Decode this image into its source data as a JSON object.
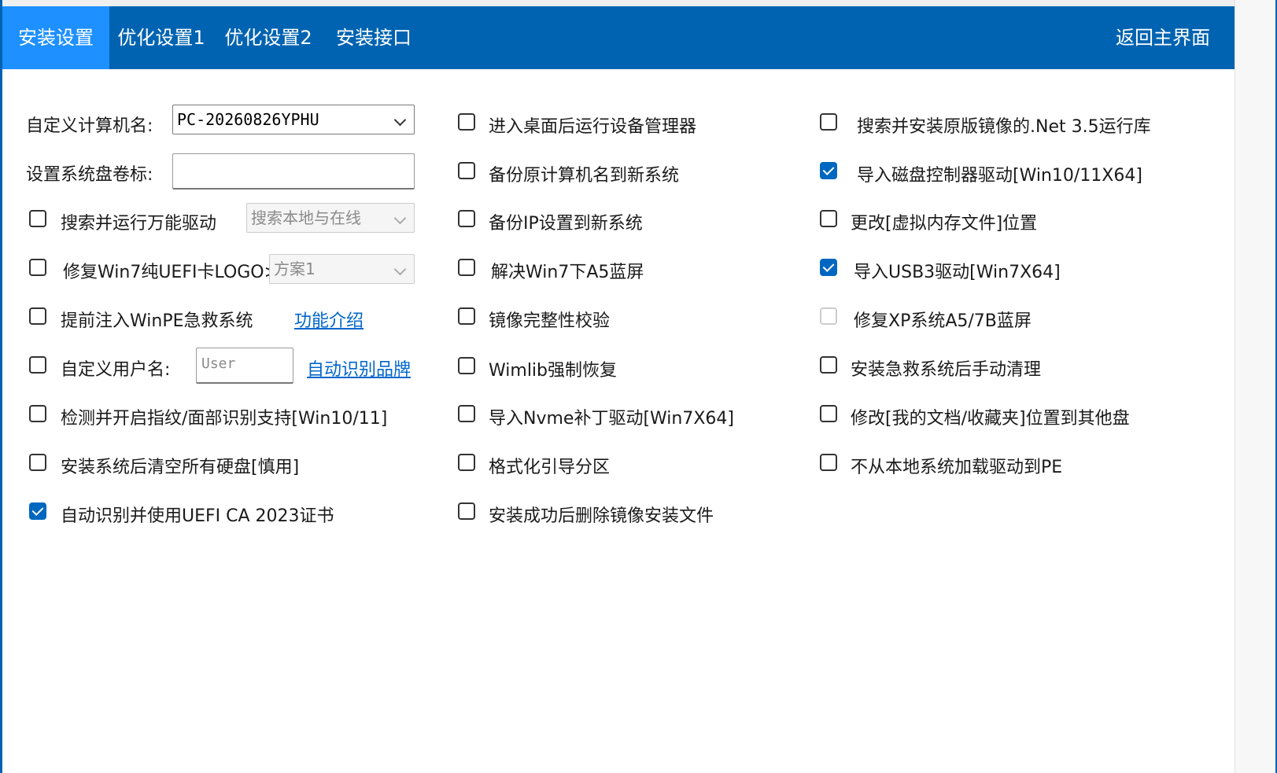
{
  "tabs": [
    {
      "label": "安装设置"
    },
    {
      "label": "优化设置1"
    },
    {
      "label": "优化设置2"
    },
    {
      "label": "安装接口"
    }
  ],
  "back_button": "返回主界面",
  "left": {
    "computer_name_label": "自定义计算机名:",
    "computer_name_value": "PC-20260826YPHU",
    "volume_label_label": "设置系统盘卷标:",
    "volume_label_value": "",
    "universal_driver": {
      "label": "搜索并运行万能驱动",
      "checked": false,
      "combo_value": "搜索本地与在线"
    },
    "fix_win7_uefi": {
      "label": "修复Win7纯UEFI卡LOGO>>",
      "checked": false,
      "combo_value": "方案1"
    },
    "inject_winpe": {
      "label": "提前注入WinPE急救系统",
      "checked": false,
      "link": "功能介绍"
    },
    "custom_user": {
      "label": "自定义用户名:",
      "checked": false,
      "input_placeholder": "User",
      "link": "自动识别品牌"
    },
    "fingerprint": {
      "label": "检测并开启指纹/面部识别支持[Win10/11]",
      "checked": false
    },
    "clear_disks": {
      "label": "安装系统后清空所有硬盘[慎用]",
      "checked": false
    },
    "uefi_ca": {
      "label": "自动识别并使用UEFI CA 2023证书",
      "checked": true
    }
  },
  "middle": [
    {
      "label": "进入桌面后运行设备管理器",
      "checked": false
    },
    {
      "label": "备份原计算机名到新系统",
      "checked": false
    },
    {
      "label": "备份IP设置到新系统",
      "checked": false
    },
    {
      "label": "解决Win7下A5蓝屏",
      "checked": false
    },
    {
      "label": "镜像完整性校验",
      "checked": false
    },
    {
      "label": "Wimlib强制恢复",
      "checked": false
    },
    {
      "label": "导入Nvme补丁驱动[Win7X64]",
      "checked": false
    },
    {
      "label": "格式化引导分区",
      "checked": false
    },
    {
      "label": "安装成功后删除镜像安装文件",
      "checked": false
    }
  ],
  "right": [
    {
      "label": "搜索并安装原版镜像的.Net 3.5运行库",
      "checked": false
    },
    {
      "label": "导入磁盘控制器驱动[Win10/11X64]",
      "checked": true
    },
    {
      "label": "更改[虚拟内存文件]位置",
      "checked": false
    },
    {
      "label": "导入USB3驱动[Win7X64]",
      "checked": true
    },
    {
      "label": "修复XP系统A5/7B蓝屏",
      "checked": false,
      "disabled": true
    },
    {
      "label": "安装急救系统后手动清理",
      "checked": false
    },
    {
      "label": "修改[我的文档/收藏夹]位置到其他盘",
      "checked": false
    },
    {
      "label": "不从本地系统加载驱动到PE",
      "checked": false
    }
  ]
}
